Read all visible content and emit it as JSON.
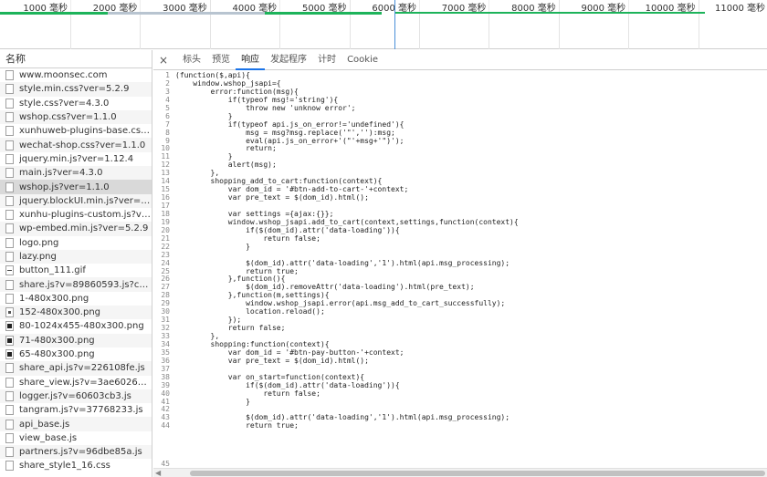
{
  "timeline": {
    "ticks": [
      "1000 毫秒",
      "2000 毫秒",
      "3000 毫秒",
      "4000 毫秒",
      "5000 毫秒",
      "6000 毫秒",
      "7000 毫秒",
      "8000 毫秒",
      "9000 毫秒",
      "10000 毫秒",
      "11000 毫秒"
    ],
    "colors": {
      "bar_green": "#1db35a",
      "bar_gray": "#b8c4d0",
      "cursor": "#4a90d9"
    }
  },
  "namecol": {
    "header": "名称",
    "items": [
      {
        "label": "www.moonsec.com",
        "icon": "file-icon"
      },
      {
        "label": "style.min.css?ver=5.2.9",
        "icon": "file-icon"
      },
      {
        "label": "style.css?ver=4.3.0",
        "icon": "file-icon"
      },
      {
        "label": "wshop.css?ver=1.1.0",
        "icon": "file-icon"
      },
      {
        "label": "xunhuweb-plugins-base.css?ver=1...",
        "icon": "file-icon"
      },
      {
        "label": "wechat-shop.css?ver=1.1.0",
        "icon": "file-icon"
      },
      {
        "label": "jquery.min.js?ver=1.12.4",
        "icon": "file-icon"
      },
      {
        "label": "main.js?ver=4.3.0",
        "icon": "file-icon"
      },
      {
        "label": "wshop.js?ver=1.1.0",
        "icon": "file-icon",
        "selected": true
      },
      {
        "label": "jquery.blockUI.min.js?ver=2.70",
        "icon": "file-icon"
      },
      {
        "label": "xunhu-plugins-custom.js?ver=1.1.0",
        "icon": "file-icon"
      },
      {
        "label": "wp-embed.min.js?ver=5.2.9",
        "icon": "file-icon"
      },
      {
        "label": "logo.png",
        "icon": "file-icon"
      },
      {
        "label": "lazy.png",
        "icon": "file-icon"
      },
      {
        "label": "button_111.gif",
        "icon": "image-dash-icon"
      },
      {
        "label": "share.js?v=89860593.js?cdnversion...",
        "icon": "file-icon"
      },
      {
        "label": "1-480x300.png",
        "icon": "file-icon"
      },
      {
        "label": "152-480x300.png",
        "icon": "image-dot-icon"
      },
      {
        "label": "80-1024x455-480x300.png",
        "icon": "image-dark-icon"
      },
      {
        "label": "71-480x300.png",
        "icon": "image-dark-icon"
      },
      {
        "label": "65-480x300.png",
        "icon": "image-dark-icon"
      },
      {
        "label": "share_api.js?v=226108fe.js",
        "icon": "file-icon"
      },
      {
        "label": "share_view.js?v=3ae6026d.js",
        "icon": "file-icon"
      },
      {
        "label": "logger.js?v=60603cb3.js",
        "icon": "file-icon"
      },
      {
        "label": "tangram.js?v=37768233.js",
        "icon": "file-icon"
      },
      {
        "label": "api_base.js",
        "icon": "file-icon"
      },
      {
        "label": "view_base.js",
        "icon": "file-icon"
      },
      {
        "label": "partners.js?v=96dbe85a.js",
        "icon": "file-icon"
      },
      {
        "label": "share_style1_16.css",
        "icon": "file-icon"
      }
    ]
  },
  "detail": {
    "tabs": [
      {
        "label": "标头"
      },
      {
        "label": "预览"
      },
      {
        "label": "响应",
        "active": true
      },
      {
        "label": "发起程序"
      },
      {
        "label": "计时"
      },
      {
        "label": "Cookie"
      }
    ],
    "code_lines": [
      "(function($,api){",
      "    window.wshop_jsapi={",
      "        error:function(msg){",
      "            if(typeof msg!='string'){",
      "                throw new 'unknow error';",
      "            }",
      "            if(typeof api.js_on_error!='undefined'){",
      "                msg = msg?msg.replace('\"',''):msg;",
      "                eval(api.js_on_error+'(\"'+msg+'\")');",
      "                return;",
      "            }",
      "            alert(msg);",
      "        },",
      "        shopping_add_to_cart:function(context){",
      "            var dom_id = '#btn-add-to-cart-'+context;",
      "            var pre_text = $(dom_id).html();",
      "",
      "            var settings ={ajax:{}};",
      "            window.wshop_jsapi.add_to_cart(context,settings,function(context){",
      "                if($(dom_id).attr('data-loading')){",
      "                    return false;",
      "                }",
      "",
      "                $(dom_id).attr('data-loading','1').html(api.msg_processing);",
      "                return true;",
      "            },function(){",
      "                $(dom_id).removeAttr('data-loading').html(pre_text);",
      "            },function(m,settings){",
      "                window.wshop_jsapi.error(api.msg_add_to_cart_successfully);",
      "                location.reload();",
      "            });",
      "            return false;",
      "        },",
      "        shopping:function(context){",
      "            var dom_id = '#btn-pay-button-'+context;",
      "            var pre_text = $(dom_id).html();",
      "",
      "            var on_start=function(context){",
      "                if($(dom_id).attr('data-loading')){",
      "                    return false;",
      "                }",
      "",
      "                $(dom_id).attr('data-loading','1').html(api.msg_processing);",
      "                return true;"
    ],
    "last_line_number": "45"
  }
}
